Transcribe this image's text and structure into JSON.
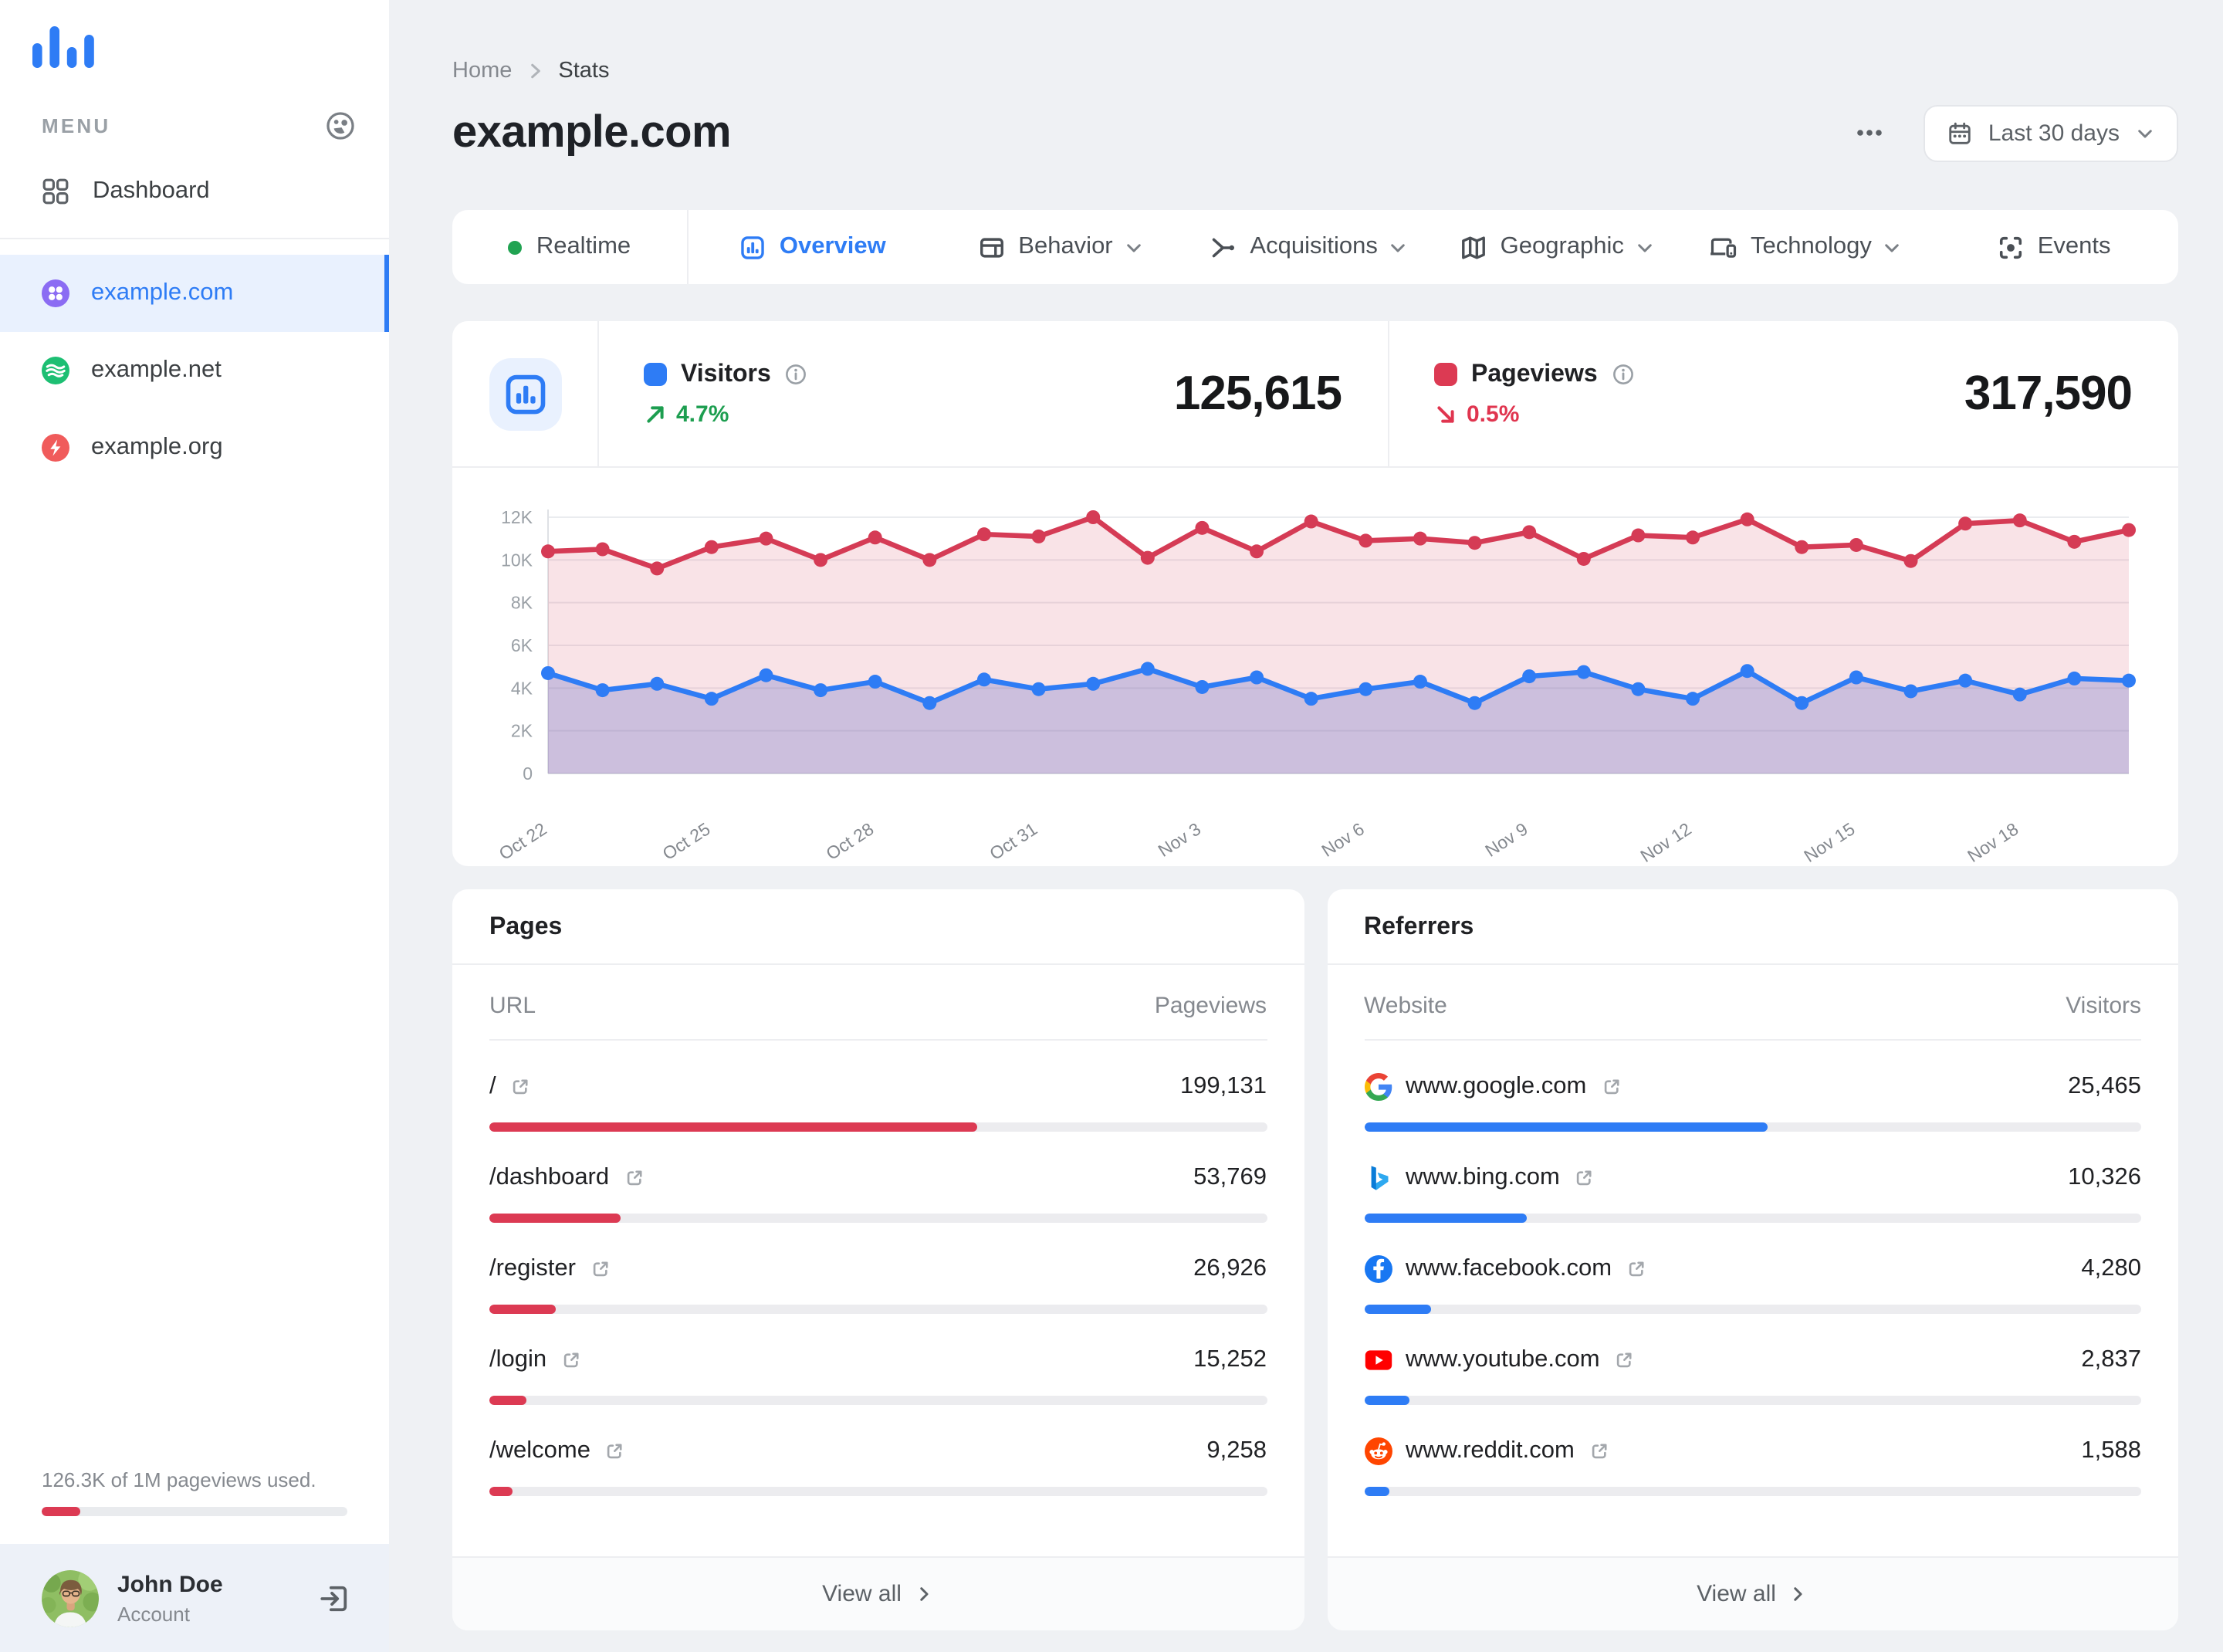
{
  "colors": {
    "accent_blue": "#2e7cf5",
    "accent_red": "#dc3a53",
    "green": "#1d9e50",
    "red_change": "#e0354f",
    "background": "#eff1f4"
  },
  "sidebar": {
    "menu_label": "MENU",
    "dashboard_label": "Dashboard",
    "sites": [
      {
        "name": "example.com",
        "icon": "clover-icon",
        "color": "#8b6cf3",
        "active": true
      },
      {
        "name": "example.net",
        "icon": "waves-icon",
        "color": "#1dbf73",
        "active": false
      },
      {
        "name": "example.org",
        "icon": "bolt-icon",
        "color": "#f05b5b",
        "active": false
      }
    ],
    "usage": {
      "text": "126.3K of 1M pageviews used.",
      "percent": 12.6,
      "bar_color": "#dc3a53"
    },
    "account": {
      "name": "John Doe",
      "label": "Account"
    }
  },
  "header": {
    "breadcrumb": [
      "Home",
      "Stats"
    ],
    "title": "example.com",
    "date_range": "Last 30 days"
  },
  "tabs": [
    {
      "label": "Realtime",
      "icon": "live-dot-icon",
      "chevron": false,
      "active": false
    },
    {
      "label": "Overview",
      "icon": "overview-chart-icon",
      "chevron": false,
      "active": true
    },
    {
      "label": "Behavior",
      "icon": "behavior-window-icon",
      "chevron": true,
      "active": false
    },
    {
      "label": "Acquisitions",
      "icon": "acquisitions-branch-icon",
      "chevron": true,
      "active": false
    },
    {
      "label": "Geographic",
      "icon": "geographic-map-icon",
      "chevron": true,
      "active": false
    },
    {
      "label": "Technology",
      "icon": "technology-devices-icon",
      "chevron": true,
      "active": false
    },
    {
      "label": "Events",
      "icon": "events-target-icon",
      "chevron": false,
      "active": false
    }
  ],
  "stats": {
    "visitors": {
      "label": "Visitors",
      "value": "125,615",
      "change": "4.7%",
      "trend": "up",
      "swatch": "#2e7cf5",
      "change_color": "#1d9e50"
    },
    "pageviews": {
      "label": "Pageviews",
      "value": "317,590",
      "change": "0.5%",
      "trend": "down",
      "swatch": "#dc3a53",
      "change_color": "#e0354f"
    }
  },
  "chart_data": {
    "type": "line",
    "x": [
      "Oct 22",
      "Oct 23",
      "Oct 24",
      "Oct 25",
      "Oct 26",
      "Oct 27",
      "Oct 28",
      "Oct 29",
      "Oct 30",
      "Oct 31",
      "Nov 1",
      "Nov 2",
      "Nov 3",
      "Nov 4",
      "Nov 5",
      "Nov 6",
      "Nov 7",
      "Nov 8",
      "Nov 9",
      "Nov 10",
      "Nov 11",
      "Nov 12",
      "Nov 13",
      "Nov 14",
      "Nov 15",
      "Nov 16",
      "Nov 17",
      "Nov 18",
      "Nov 19",
      "Nov 20"
    ],
    "x_tick_labels": [
      "Oct 22",
      "Oct 25",
      "Oct 28",
      "Oct 31",
      "Nov 3",
      "Nov 6",
      "Nov 9",
      "Nov 12",
      "Nov 15",
      "Nov 18"
    ],
    "series": [
      {
        "name": "Pageviews",
        "color": "#d53b55",
        "fill": "rgba(213,59,85,0.14)",
        "values": [
          10400,
          10500,
          9600,
          10600,
          11000,
          10000,
          11050,
          10000,
          11200,
          11100,
          12000,
          10100,
          11500,
          10400,
          11800,
          10900,
          11000,
          10800,
          11300,
          10050,
          11150,
          11050,
          11900,
          10600,
          10700,
          9950,
          11700,
          11850,
          10850,
          11400
        ]
      },
      {
        "name": "Visitors",
        "color": "#2e7cf5",
        "fill": "rgba(100,108,200,0.30)",
        "values": [
          4700,
          3900,
          4200,
          3500,
          4600,
          3900,
          4300,
          3300,
          4400,
          3950,
          4200,
          4900,
          4050,
          4500,
          3500,
          3950,
          4300,
          3300,
          4550,
          4750,
          3950,
          3500,
          4800,
          3300,
          4500,
          3850,
          4350,
          3700,
          4450,
          4350
        ]
      }
    ],
    "ylim": [
      0,
      12000
    ],
    "y_ticks": [
      "0",
      "2K",
      "4K",
      "6K",
      "8K",
      "10K",
      "12K"
    ],
    "grid": true,
    "legend": "none"
  },
  "pages": {
    "title": "Pages",
    "columns": [
      "URL",
      "Pageviews"
    ],
    "bar_color": "#dc3a53",
    "rows": [
      {
        "label": "/",
        "value": "199,131",
        "bar_percent": 62.7
      },
      {
        "label": "/dashboard",
        "value": "53,769",
        "bar_percent": 16.9
      },
      {
        "label": "/register",
        "value": "26,926",
        "bar_percent": 8.5
      },
      {
        "label": "/login",
        "value": "15,252",
        "bar_percent": 4.8
      },
      {
        "label": "/welcome",
        "value": "9,258",
        "bar_percent": 2.9
      }
    ],
    "view_all": "View all"
  },
  "referrers": {
    "title": "Referrers",
    "columns": [
      "Website",
      "Visitors"
    ],
    "bar_color": "#2e7cf5",
    "rows": [
      {
        "label": "www.google.com",
        "value": "25,465",
        "bar_percent": 52,
        "icon": "google-favicon"
      },
      {
        "label": "www.bing.com",
        "value": "10,326",
        "bar_percent": 21,
        "icon": "bing-favicon"
      },
      {
        "label": "www.facebook.com",
        "value": "4,280",
        "bar_percent": 8.7,
        "icon": "facebook-favicon"
      },
      {
        "label": "www.youtube.com",
        "value": "2,837",
        "bar_percent": 5.8,
        "icon": "youtube-favicon"
      },
      {
        "label": "www.reddit.com",
        "value": "1,588",
        "bar_percent": 3.2,
        "icon": "reddit-favicon"
      }
    ],
    "view_all": "View all"
  }
}
